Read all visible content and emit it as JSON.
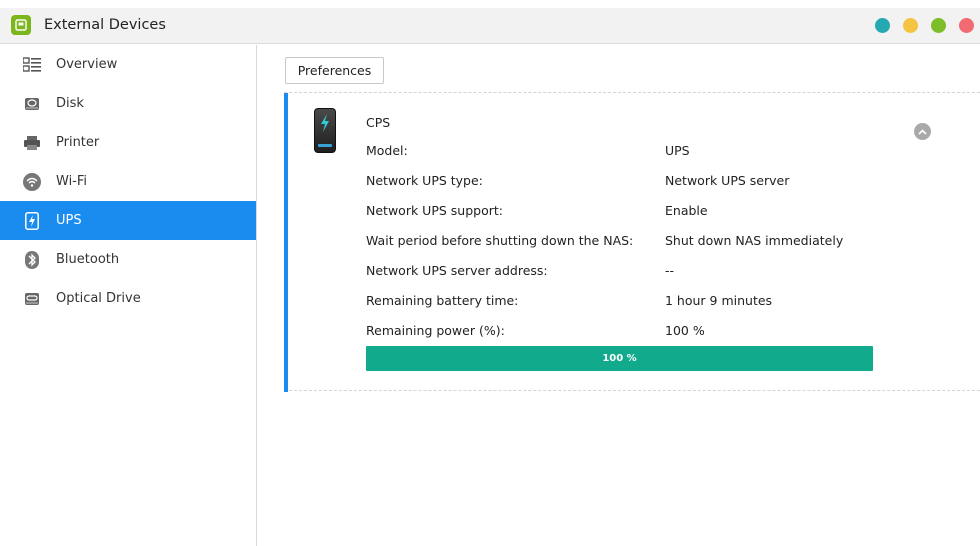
{
  "window": {
    "title": "External Devices",
    "controls": [
      {
        "name": "info-dot",
        "color": "#26a8b0"
      },
      {
        "name": "minimize-dot",
        "color": "#f5c342"
      },
      {
        "name": "maximize-dot",
        "color": "#7dbd2a"
      },
      {
        "name": "close-dot",
        "color": "#f26b72"
      }
    ]
  },
  "sidebar": {
    "items": [
      {
        "label": "Overview",
        "icon": "overview-icon",
        "active": false
      },
      {
        "label": "Disk",
        "icon": "disk-icon",
        "active": false
      },
      {
        "label": "Printer",
        "icon": "printer-icon",
        "active": false
      },
      {
        "label": "Wi-Fi",
        "icon": "wifi-icon",
        "active": false
      },
      {
        "label": "UPS",
        "icon": "ups-icon",
        "active": true
      },
      {
        "label": "Bluetooth",
        "icon": "bluetooth-icon",
        "active": false
      },
      {
        "label": "Optical Drive",
        "icon": "optical-drive-icon",
        "active": false
      }
    ]
  },
  "main": {
    "preferences_label": "Preferences",
    "device": {
      "name": "CPS",
      "rows": [
        {
          "label": "Model:",
          "value": "UPS"
        },
        {
          "label": "Network UPS type:",
          "value": "Network UPS server"
        },
        {
          "label": "Network UPS support:",
          "value": "Enable"
        },
        {
          "label": "Wait period before shutting down the NAS:",
          "value": "Shut down NAS immediately"
        },
        {
          "label": "Network UPS server address:",
          "value": "--"
        },
        {
          "label": "Remaining battery time:",
          "value": "1 hour 9 minutes"
        },
        {
          "label": "Remaining power (%):",
          "value": "100 %"
        }
      ],
      "power_bar": {
        "fraction": 1.0,
        "text": "100 %"
      }
    }
  },
  "colors": {
    "accent": "#1a8cf0",
    "progress": "#12aa8c"
  }
}
